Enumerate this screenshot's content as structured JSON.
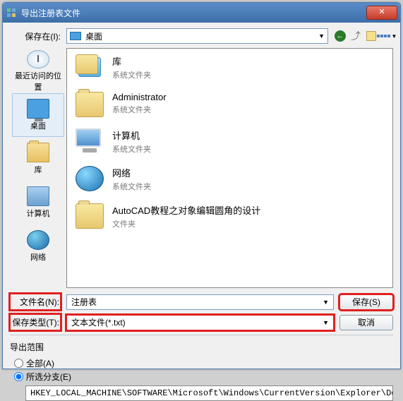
{
  "title": "导出注册表文件",
  "save_in_label": "保存在(I):",
  "location_text": "桌面",
  "places": {
    "recent": "最近访问的位置",
    "desktop": "桌面",
    "libraries": "库",
    "computer": "计算机",
    "network": "网络"
  },
  "items": [
    {
      "name": "库",
      "type": "系统文件夹",
      "icon": "lib"
    },
    {
      "name": "Administrator",
      "type": "系统文件夹",
      "icon": "fold"
    },
    {
      "name": "计算机",
      "type": "系统文件夹",
      "icon": "comp"
    },
    {
      "name": "网络",
      "type": "系统文件夹",
      "icon": "net"
    },
    {
      "name": "AutoCAD教程之对象编辑圆角的设计",
      "type": "文件夹",
      "icon": "fold"
    }
  ],
  "filename_label": "文件名(N):",
  "filename_value": "注册表",
  "filetype_label": "保存类型(T):",
  "filetype_value": "文本文件(*.txt)",
  "save_button": "保存(S)",
  "cancel_button": "取消",
  "export_range": {
    "title": "导出范围",
    "all": "全部(A)",
    "selected": "所选分支(E)",
    "path": "HKEY_LOCAL_MACHINE\\SOFTWARE\\Microsoft\\Windows\\CurrentVersion\\Explorer\\Desktop\\Nam"
  }
}
